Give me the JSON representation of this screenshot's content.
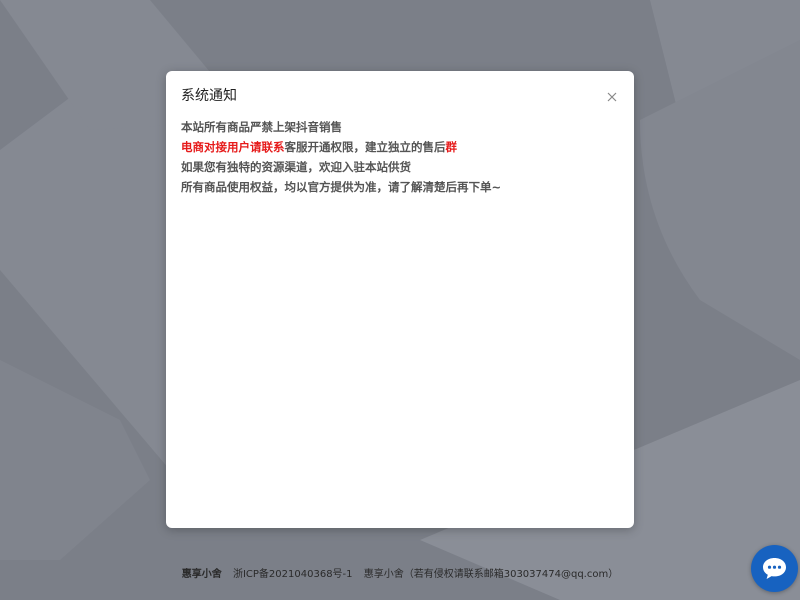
{
  "modal": {
    "title": "系统通知",
    "lines": [
      {
        "parts": [
          {
            "text": "本站所有商品严禁上架抖音销售",
            "color": "#555555"
          }
        ]
      },
      {
        "parts": [
          {
            "text": "电商对接用户请联系",
            "color": "#e61a1a"
          },
          {
            "text": "客服开通权限，建立独立的售后",
            "color": "#555555"
          },
          {
            "text": "群",
            "color": "#e61a1a"
          }
        ]
      },
      {
        "parts": [
          {
            "text": "如果您有独特的资源渠道，欢迎入驻本站供货",
            "color": "#555555"
          }
        ]
      },
      {
        "parts": [
          {
            "text": "所有商品使用权益，均以官方提供为准，请了解清楚后再下单~",
            "color": "#555555"
          }
        ]
      }
    ],
    "close_icon": "close-icon"
  },
  "footer": {
    "brand": "惠享小舍",
    "icp": "浙ICP备2021040368号-1",
    "contact": "惠享小舍（若有侵权请联系邮箱303037474@qq.com）"
  },
  "chat": {
    "icon": "chat-bubble-icon",
    "color": "#1762c0"
  },
  "colors": {
    "accent_red": "#e61a1a",
    "overlay": "#7b7f88"
  }
}
